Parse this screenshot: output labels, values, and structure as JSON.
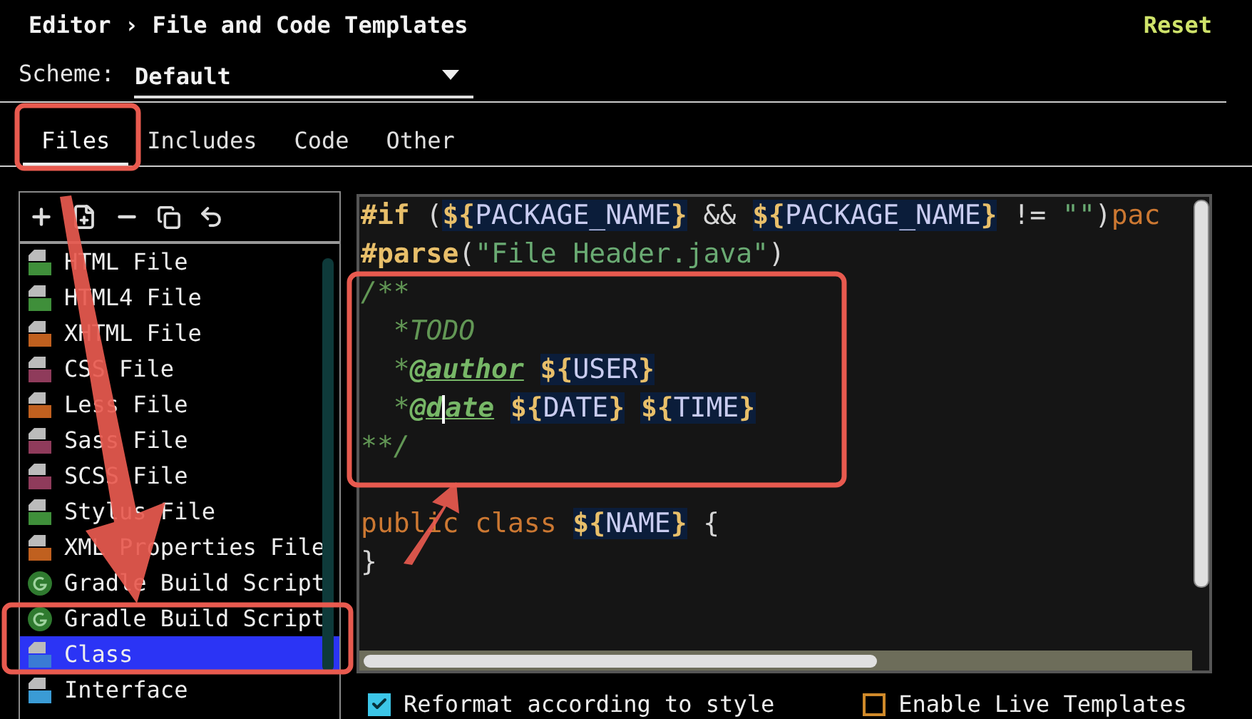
{
  "breadcrumb": {
    "parent": "Editor",
    "separator": "›",
    "title": "File and Code Templates"
  },
  "reset": "Reset",
  "scheme": {
    "label": "Scheme:",
    "value": "Default"
  },
  "tabs": [
    {
      "label": "Files",
      "selected": true
    },
    {
      "label": "Includes",
      "selected": false
    },
    {
      "label": "Code",
      "selected": false
    },
    {
      "label": "Other",
      "selected": false
    }
  ],
  "templates": [
    {
      "name": "HTML File",
      "kind": "file",
      "color": "#3f8f3a",
      "selected": false
    },
    {
      "name": "HTML4 File",
      "kind": "file",
      "color": "#3f8f3a",
      "selected": false
    },
    {
      "name": "XHTML File",
      "kind": "file",
      "color": "#c0601f",
      "selected": false
    },
    {
      "name": "CSS File",
      "kind": "file",
      "color": "#8f3b5b",
      "selected": false
    },
    {
      "name": "Less File",
      "kind": "file",
      "color": "#c0601f",
      "selected": false
    },
    {
      "name": "Sass File",
      "kind": "file",
      "color": "#8f3b5b",
      "selected": false
    },
    {
      "name": "SCSS File",
      "kind": "file",
      "color": "#8f3b5b",
      "selected": false
    },
    {
      "name": "Stylus File",
      "kind": "file",
      "color": "#3f8f3a",
      "selected": false
    },
    {
      "name": "XML Properties File",
      "kind": "file",
      "color": "#c0601f",
      "selected": false
    },
    {
      "name": "Gradle Build Script",
      "kind": "gradle",
      "color": "#2f7a2f",
      "selected": false
    },
    {
      "name": "Gradle Build Script",
      "kind": "gradle",
      "color": "#2f7a2f",
      "selected": false
    },
    {
      "name": "Class",
      "kind": "file",
      "color": "#3a7bd5",
      "selected": true
    },
    {
      "name": "Interface",
      "kind": "file",
      "color": "#3a9bd5",
      "selected": false
    }
  ],
  "code_lines": [
    {
      "tokens": [
        {
          "kind": "directive",
          "text": "#if"
        },
        {
          "kind": "plain",
          "text": " ("
        },
        {
          "kind": "brace",
          "text": "${"
        },
        {
          "kind": "var",
          "text": "PACKAGE_NAME"
        },
        {
          "kind": "brace",
          "text": "}"
        },
        {
          "kind": "plain",
          "text": " && "
        },
        {
          "kind": "brace",
          "text": "${"
        },
        {
          "kind": "var",
          "text": "PACKAGE_NAME"
        },
        {
          "kind": "brace",
          "text": "}"
        },
        {
          "kind": "plain",
          "text": " != "
        },
        {
          "kind": "string",
          "text": "\"\""
        },
        {
          "kind": "plain",
          "text": ")"
        },
        {
          "kind": "keyword",
          "text": "pac"
        }
      ]
    },
    {
      "tokens": [
        {
          "kind": "directive",
          "text": "#parse"
        },
        {
          "kind": "plain",
          "text": "("
        },
        {
          "kind": "string",
          "text": "\"File Header.java\""
        },
        {
          "kind": "plain",
          "text": ")"
        }
      ]
    },
    {
      "tokens": [
        {
          "kind": "comment",
          "text": "/**"
        }
      ]
    },
    {
      "tokens": [
        {
          "kind": "comment",
          "text": "  *TODO"
        }
      ]
    },
    {
      "tokens": [
        {
          "kind": "comment",
          "text": "  *"
        },
        {
          "kind": "doctag",
          "text": "@author"
        },
        {
          "kind": "brace",
          "text": "${",
          "gap_before": true
        },
        {
          "kind": "var",
          "text": "USER"
        },
        {
          "kind": "brace",
          "text": "}"
        }
      ]
    },
    {
      "tokens": [
        {
          "kind": "comment",
          "text": "  *"
        },
        {
          "kind": "doctag",
          "text": "@d"
        },
        {
          "kind": "caret"
        },
        {
          "kind": "doctag",
          "text": "ate"
        },
        {
          "kind": "brace",
          "text": "${",
          "gap_before": true
        },
        {
          "kind": "var",
          "text": "DATE"
        },
        {
          "kind": "brace",
          "text": "}"
        },
        {
          "kind": "brace",
          "text": "${",
          "gap_before": true
        },
        {
          "kind": "var",
          "text": "TIME"
        },
        {
          "kind": "brace",
          "text": "}"
        }
      ]
    },
    {
      "tokens": [
        {
          "kind": "comment",
          "text": "**/"
        }
      ]
    },
    {
      "space_above": true,
      "tokens": [
        {
          "kind": "keyword",
          "text": "public class"
        },
        {
          "kind": "brace",
          "text": "${",
          "gap_before": true
        },
        {
          "kind": "var",
          "text": "NAME"
        },
        {
          "kind": "brace",
          "text": "}"
        },
        {
          "kind": "plain",
          "text": "{",
          "gap_before": true
        }
      ]
    },
    {
      "tokens": [
        {
          "kind": "plain",
          "text": "}"
        }
      ]
    }
  ],
  "options": [
    {
      "label": "Reformat according to style",
      "checked": true
    },
    {
      "label": "Enable Live Templates",
      "checked": false
    }
  ]
}
